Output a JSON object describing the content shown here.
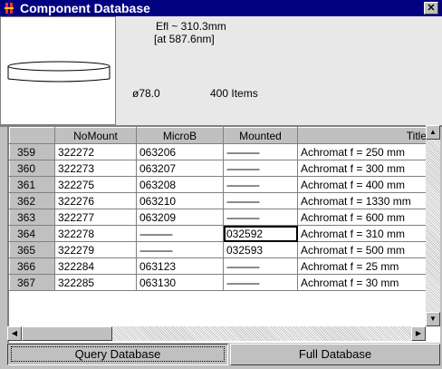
{
  "window": {
    "title": "Component Database",
    "close_glyph": "✕"
  },
  "info": {
    "efl": "Efl ~ 310.3mm",
    "wavelength": "[at 587.6nm]",
    "diameter": "ø78.0",
    "count": "400 Items",
    "preview_icon": "lens-outline-icon"
  },
  "grid": {
    "columns": [
      "",
      "NoMount",
      "MicroB",
      "Mounted",
      "Title"
    ],
    "rows": [
      {
        "id": "359",
        "nomount": "322272",
        "microb": "063206",
        "mounted": "------------",
        "title": "Achromat  f = 250 mm"
      },
      {
        "id": "360",
        "nomount": "322273",
        "microb": "063207",
        "mounted": "------------",
        "title": "Achromat  f = 300 mm"
      },
      {
        "id": "361",
        "nomount": "322275",
        "microb": "063208",
        "mounted": "------------",
        "title": "Achromat  f = 400 mm"
      },
      {
        "id": "362",
        "nomount": "322276",
        "microb": "063210",
        "mounted": "------------",
        "title": "Achromat  f = 1330 mm"
      },
      {
        "id": "363",
        "nomount": "322277",
        "microb": "063209",
        "mounted": "------------",
        "title": "Achromat  f = 600 mm"
      },
      {
        "id": "364",
        "nomount": "322278",
        "microb": "------------",
        "mounted": "032592",
        "title": "Achromat  f = 310 mm"
      },
      {
        "id": "365",
        "nomount": "322279",
        "microb": "------------",
        "mounted": "032593",
        "title": "Achromat  f = 500 mm"
      },
      {
        "id": "366",
        "nomount": "322284",
        "microb": "063123",
        "mounted": "------------",
        "title": "Achromat  f = 25 mm"
      },
      {
        "id": "367",
        "nomount": "322285",
        "microb": "063130",
        "mounted": "------------",
        "title": "Achromat  f = 30 mm"
      }
    ]
  },
  "buttons": {
    "query": "Query Database",
    "full": "Full Database"
  },
  "colors": {
    "titlebar": "#000080",
    "face": "#c0c0c0",
    "info_bg": "#e8e8e8"
  }
}
